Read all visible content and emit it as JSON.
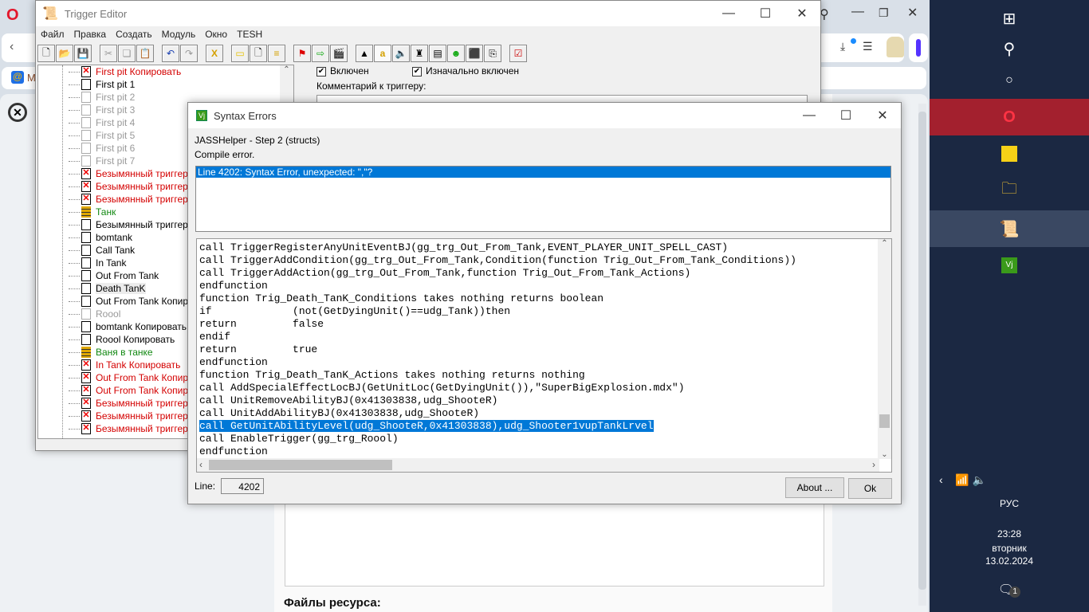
{
  "browser": {
    "bookmark_label": "M",
    "page_heading": "Файлы ресурса:"
  },
  "trigger_editor": {
    "title": "Trigger Editor",
    "menu": [
      "Файл",
      "Правка",
      "Создать",
      "Модуль",
      "Окно",
      "TESH"
    ],
    "enabled_label": "Включен",
    "initially_enabled_label": "Изначально включен",
    "comment_label": "Комментарий к триггеру:",
    "tree": [
      {
        "label": "First pit Копировать",
        "state": "error"
      },
      {
        "label": "First pit 1",
        "state": "normal"
      },
      {
        "label": "First pit 2",
        "state": "disabled"
      },
      {
        "label": "First pit 3",
        "state": "disabled"
      },
      {
        "label": "First pit 4",
        "state": "disabled"
      },
      {
        "label": "First pit 5",
        "state": "disabled"
      },
      {
        "label": "First pit  6",
        "state": "disabled"
      },
      {
        "label": "First pit 7",
        "state": "disabled"
      },
      {
        "label": "Безымянный триггер 002",
        "state": "error"
      },
      {
        "label": "Безымянный триггер 134",
        "state": "error"
      },
      {
        "label": "Безымянный триггер 020",
        "state": "error"
      },
      {
        "label": "Танк",
        "state": "category"
      },
      {
        "label": "Безымянный триггер 002",
        "state": "normal"
      },
      {
        "label": "bomtank",
        "state": "normal"
      },
      {
        "label": "Call Tank",
        "state": "normal"
      },
      {
        "label": "In Tank",
        "state": "normal"
      },
      {
        "label": "Out From Tank",
        "state": "normal"
      },
      {
        "label": "Death TanK",
        "state": "normal"
      },
      {
        "label": "Out From Tank Копировать",
        "state": "normal"
      },
      {
        "label": "Roool",
        "state": "disabled"
      },
      {
        "label": "bomtank Копировать",
        "state": "normal"
      },
      {
        "label": "Roool Копировать",
        "state": "normal"
      },
      {
        "label": "Ваня в танке",
        "state": "category"
      },
      {
        "label": "In Tank Копировать",
        "state": "error"
      },
      {
        "label": "Out From Tank Копировать",
        "state": "error"
      },
      {
        "label": "Out From Tank Копировать",
        "state": "error"
      },
      {
        "label": "Безымянный триггер 145",
        "state": "error"
      },
      {
        "label": "Безымянный триггер 112",
        "state": "error"
      },
      {
        "label": "Безымянный триггер 053",
        "state": "error"
      }
    ]
  },
  "dialog": {
    "title": "Syntax Errors",
    "step": "JASSHelper - Step 2 (structs)",
    "status": "Compile error.",
    "errors": [
      "Line 4202: Syntax Error, unexpected: \",\"?"
    ],
    "code": [
      "call TriggerRegisterAnyUnitEventBJ(gg_trg_Out_From_Tank,EVENT_PLAYER_UNIT_SPELL_CAST)",
      "call TriggerAddCondition(gg_trg_Out_From_Tank,Condition(function Trig_Out_From_Tank_Conditions))",
      "call TriggerAddAction(gg_trg_Out_From_Tank,function Trig_Out_From_Tank_Actions)",
      "endfunction",
      "function Trig_Death_TanK_Conditions takes nothing returns boolean",
      "if             (not(GetDyingUnit()==udg_Tank))then",
      "return         false",
      "endif",
      "return         true",
      "endfunction",
      "function Trig_Death_TanK_Actions takes nothing returns nothing",
      "call AddSpecialEffectLocBJ(GetUnitLoc(GetDyingUnit()),\"SuperBigExplosion.mdx\")",
      "call UnitRemoveAbilityBJ(0x41303838,udg_ShooteR)",
      "call UnitAddAbilityBJ(0x41303838,udg_ShooteR)",
      "call GetUnitAbilityLevel(udg_ShooteR,0x41303838),udg_Shooter1vupTankLrvel",
      "call EnableTrigger(gg_trg_Roool)",
      "endfunction"
    ],
    "selected_line_index": 14,
    "line_label": "Line:",
    "line_value": "4202",
    "about_label": "About ...",
    "ok_label": "Ok"
  },
  "tray": {
    "lang": "РУС",
    "time": "23:28",
    "day": "вторник",
    "date": "13.02.2024",
    "notifications": "1"
  }
}
